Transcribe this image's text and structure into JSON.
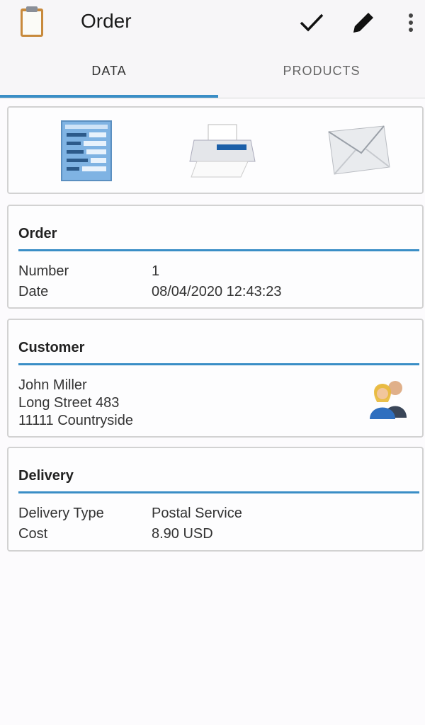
{
  "app_bar": {
    "title": "Order",
    "icons": [
      "clipboard-icon",
      "check-icon",
      "pencil-icon",
      "more-vert-icon"
    ]
  },
  "tabs": [
    {
      "label": "DATA",
      "active": true
    },
    {
      "label": "PRODUCTS",
      "active": false
    }
  ],
  "actions": [
    "form-icon",
    "printer-icon",
    "envelope-icon"
  ],
  "order": {
    "heading": "Order",
    "number_label": "Number",
    "number_value": "1",
    "date_label": "Date",
    "date_value": "08/04/2020 12:43:23"
  },
  "customer": {
    "heading": "Customer",
    "name": "John Miller",
    "street": "Long Street 483",
    "city": "11111 Countryside"
  },
  "delivery": {
    "heading": "Delivery",
    "type_label": "Delivery Type",
    "type_value": "Postal Service",
    "cost_label": "Cost",
    "cost_value": "8.90 USD"
  },
  "colors": {
    "accent": "#3a8ec6",
    "background": "#fcfbfd"
  }
}
